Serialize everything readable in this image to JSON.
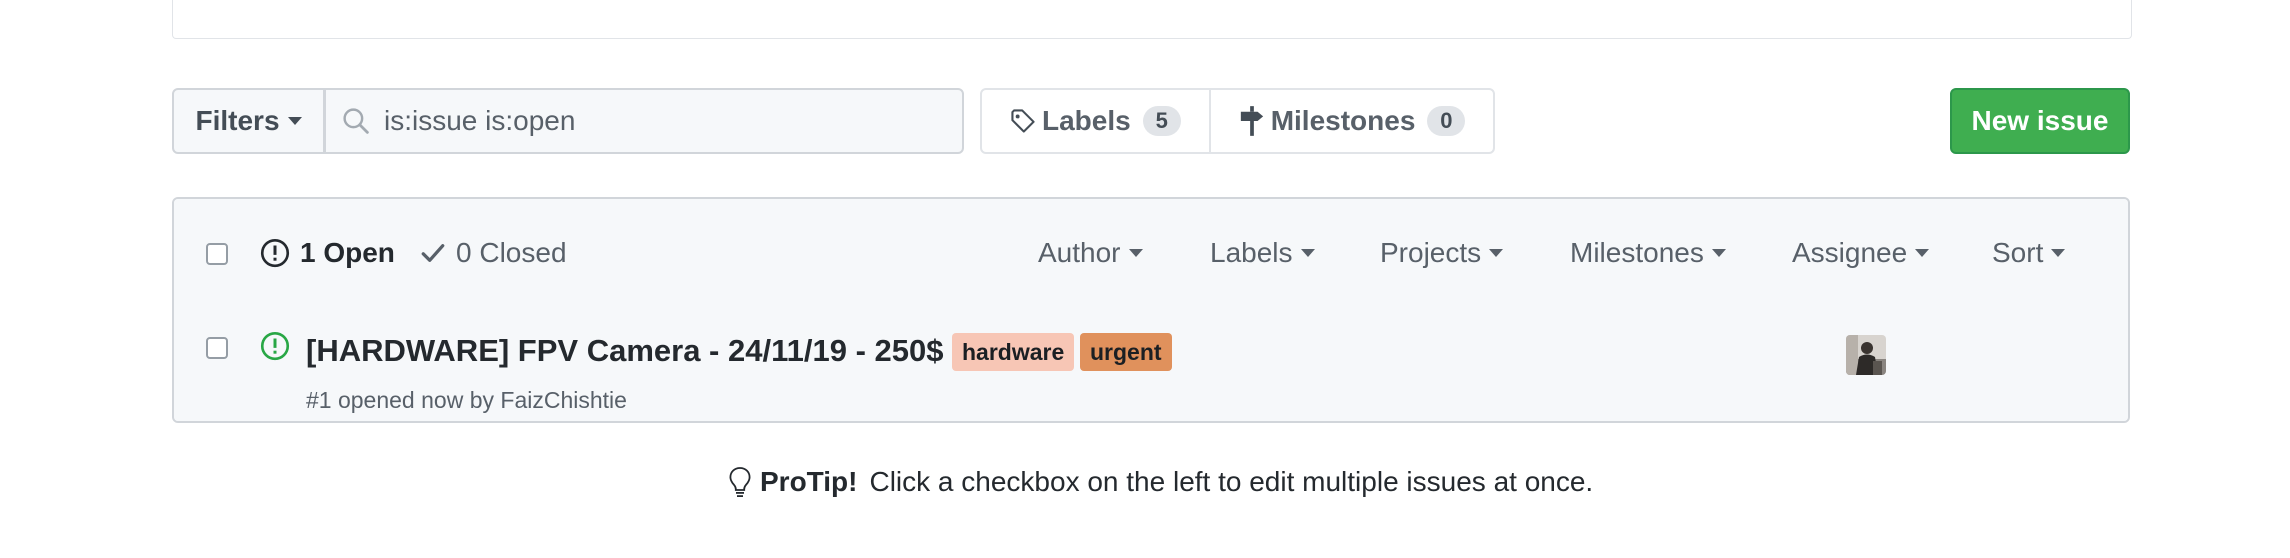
{
  "toolbar": {
    "filters_label": "Filters",
    "search_value": "is:issue is:open",
    "labels_label": "Labels",
    "labels_count": "5",
    "milestones_label": "Milestones",
    "milestones_count": "0",
    "new_issue_label": "New issue"
  },
  "list_header": {
    "open_label": "1 Open",
    "closed_label": "0 Closed",
    "filters": [
      "Author",
      "Labels",
      "Projects",
      "Milestones",
      "Assignee",
      "Sort"
    ]
  },
  "issues": [
    {
      "title": "[HARDWARE] FPV Camera - 24/11/19 - 250$",
      "labels": [
        {
          "name": "hardware",
          "color": "#f7c6b5"
        },
        {
          "name": "urgent",
          "color": "#e0915c"
        }
      ],
      "meta_prefix": "#1 opened now by ",
      "author": "FaizChishtie"
    }
  ],
  "protip": {
    "title": "ProTip!",
    "text": "Click a checkbox on the left to edit multiple issues at once."
  },
  "colors": {
    "accent_green": "#3fae50",
    "open_icon_green": "#28a745"
  }
}
